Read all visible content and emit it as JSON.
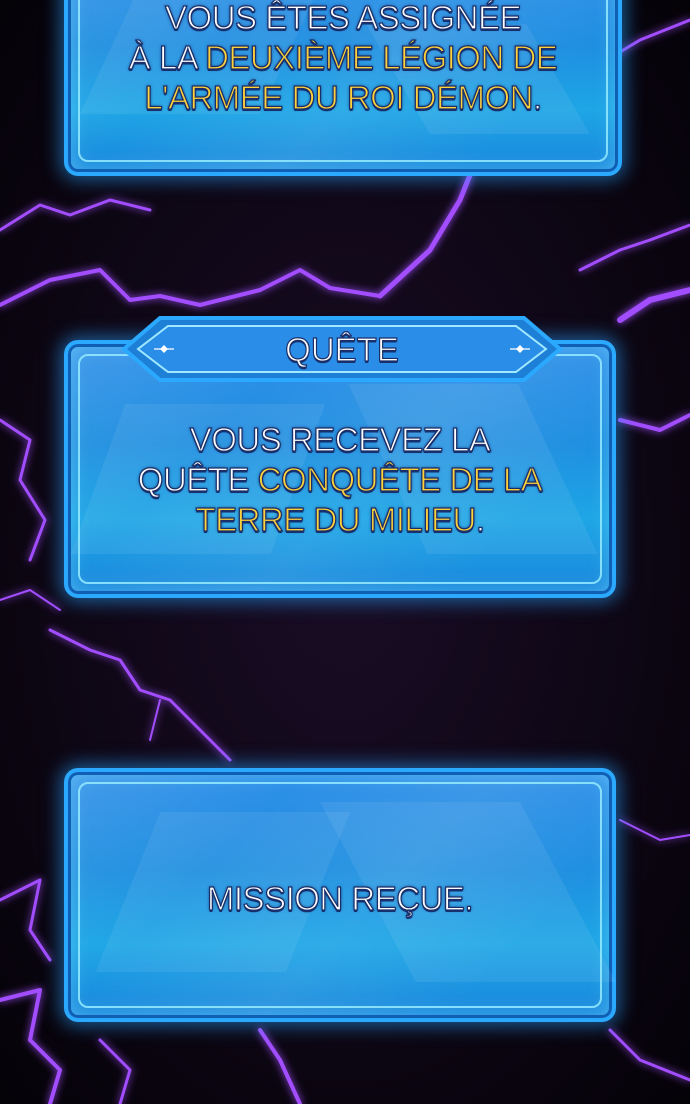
{
  "panels": {
    "top": {
      "line1": "VOUS ÊTES ASSIGNÉE",
      "line2_plain": "À LA ",
      "line2_highlight": "DEUXIÈME LÉGION DE",
      "line3_highlight": "L'ARMÉE DU ROI DÉMON",
      "line3_plain": "."
    },
    "quest": {
      "header": "QUÊTE",
      "line1": "VOUS RECEVEZ LA",
      "line2_plain": "QUÊTE ",
      "line2_highlight": "CONQUÊTE DE LA",
      "line3_highlight": "TERRE DU MILIEU",
      "line3_plain": "."
    },
    "mission": {
      "text": "MISSION REÇUE."
    }
  },
  "colors": {
    "background": "#0a0510",
    "lightning": "#a24dff",
    "panel_blue": "#1f8fe0",
    "highlight_text": "#ffd23a"
  },
  "icons": [
    "lightning-bolts",
    "diamond-sparkle-icon"
  ]
}
